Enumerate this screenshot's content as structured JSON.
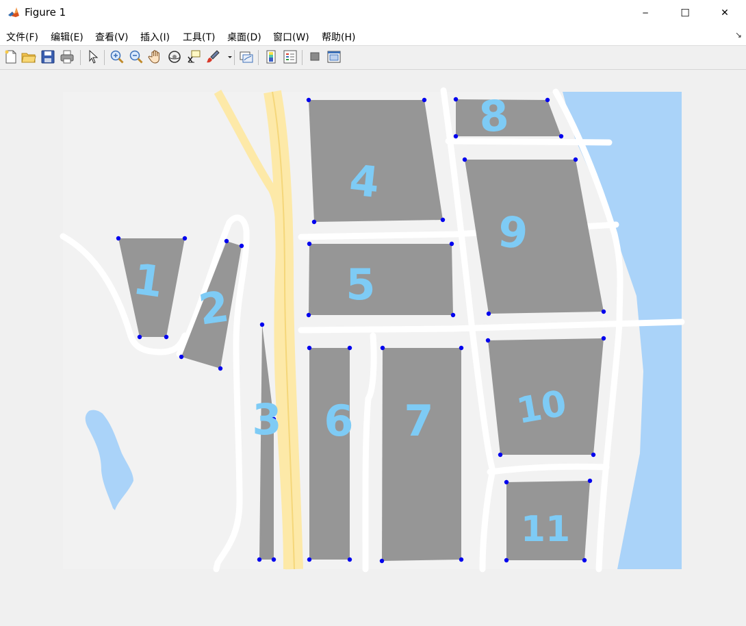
{
  "window": {
    "title": "Figure 1",
    "minimize_glyph": "─",
    "maximize_glyph": "☐",
    "close_glyph": "✕"
  },
  "menu": {
    "items": [
      {
        "label": "文件(F)"
      },
      {
        "label": "编辑(E)"
      },
      {
        "label": "查看(V)"
      },
      {
        "label": "插入(I)"
      },
      {
        "label": "工具(T)"
      },
      {
        "label": "桌面(D)"
      },
      {
        "label": "窗口(W)"
      },
      {
        "label": "帮助(H)"
      }
    ],
    "dock_arrow": "↘"
  },
  "toolbar": {
    "tools": [
      "new-file-icon",
      "open-folder-icon",
      "save-icon",
      "print-icon",
      "pointer-icon",
      "zoom-in-icon",
      "zoom-out-icon",
      "pan-hand-icon",
      "rotate-3d-icon",
      "data-cursor-icon",
      "brush-icon",
      "link-plot-icon",
      "colorbar-icon",
      "legend-icon",
      "hide-plot-tools-icon",
      "show-plot-tools-icon"
    ]
  },
  "map": {
    "colors": {
      "land": "#f2f2f2",
      "road": "#ffffff",
      "highway": "#fde9a8",
      "highway_edge": "#f5d77a",
      "water": "#aad3f9",
      "block": "#969696",
      "vertex": "#0000ee",
      "label": "#7ecbf5"
    },
    "blocks": [
      {
        "label": "1"
      },
      {
        "label": "2"
      },
      {
        "label": "3"
      },
      {
        "label": "4"
      },
      {
        "label": "5"
      },
      {
        "label": "6"
      },
      {
        "label": "7"
      },
      {
        "label": "8"
      },
      {
        "label": "9"
      },
      {
        "label": "10"
      },
      {
        "label": "11"
      }
    ]
  }
}
